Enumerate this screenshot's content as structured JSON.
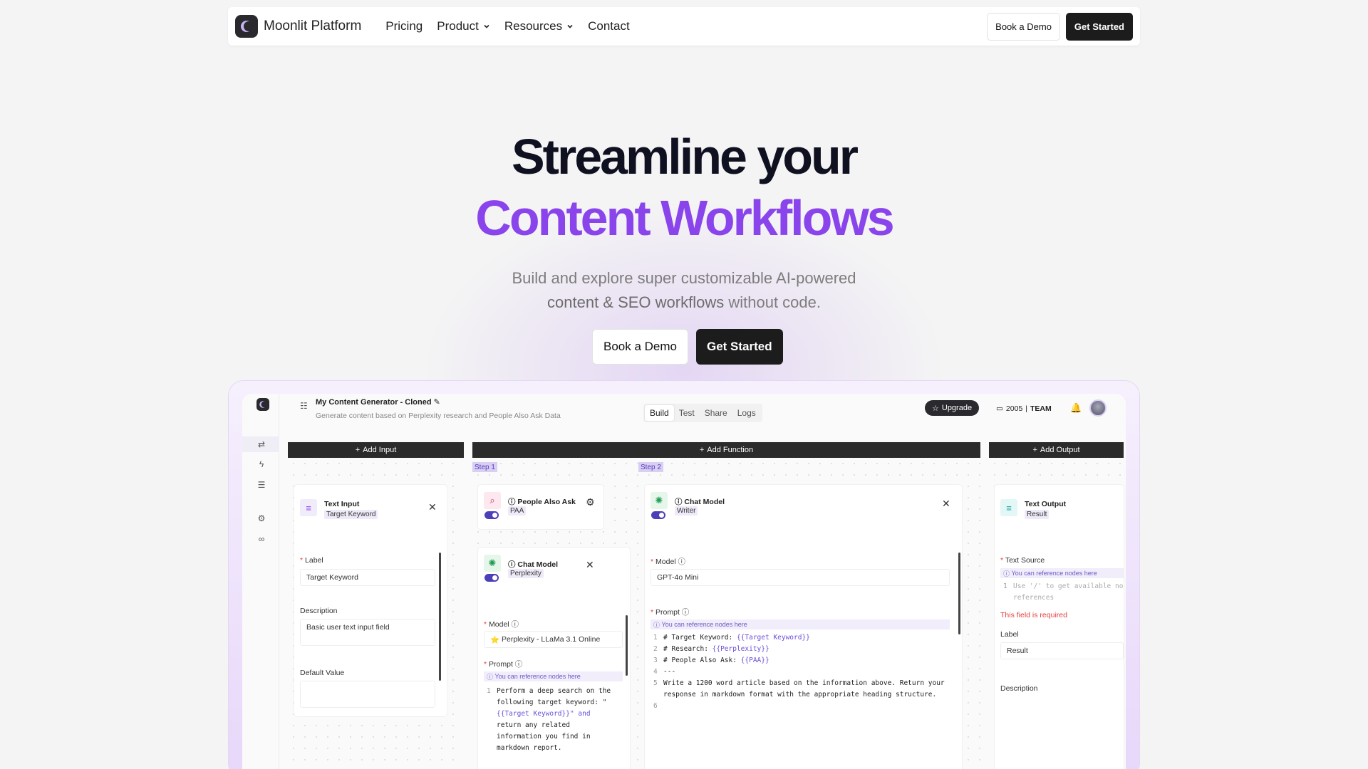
{
  "nav": {
    "brand": "Moonlit Platform",
    "links": [
      "Pricing",
      "Product",
      "Resources",
      "Contact"
    ],
    "book_demo": "Book a Demo",
    "get_started": "Get Started"
  },
  "hero": {
    "title_line1": "Streamline your",
    "title_line2": "Content Workflows",
    "subtitle_line1": "Build and explore super customizable AI-powered",
    "subtitle_line2_strong": "content & SEO workflows",
    "subtitle_line2_rest": " without code.",
    "book_demo": "Book a Demo",
    "get_started": "Get Started"
  },
  "app": {
    "title": "My Content Generator - Cloned",
    "description": "Generate content based on Perplexity research and People Also Ask Data",
    "tabs": [
      "Build",
      "Test",
      "Share",
      "Logs"
    ],
    "upgrade": "Upgrade",
    "credits": "2005",
    "plan": "TEAM",
    "add_input": "Add Input",
    "add_function": "Add Function",
    "add_output": "Add Output",
    "step1": "Step 1",
    "step2": "Step 2",
    "text_input": {
      "title": "Text Input",
      "tag": "Target Keyword",
      "label_label": "Label",
      "label_value": "Target Keyword",
      "description_label": "Description",
      "description_value": "Basic user text input field",
      "default_label": "Default Value"
    },
    "paa": {
      "title": "People Also Ask",
      "tag": "PAA"
    },
    "chat1": {
      "title": "Chat Model",
      "tag": "Perplexity",
      "model_label": "Model",
      "model_value": "Perplexity - LLaMa 3.1 Online",
      "prompt_label": "Prompt",
      "hint": "You can reference nodes here",
      "prompt_lines": [
        "Perform a deep search on the",
        "following target keyword: \"",
        "{{Target Keyword}}\" and",
        "return any related",
        "information you find in",
        "markdown report."
      ]
    },
    "chat2": {
      "title": "Chat Model",
      "tag": "Writer",
      "model_label": "Model",
      "model_value": "GPT-4o Mini",
      "prompt_label": "Prompt",
      "hint": "You can reference nodes here",
      "line1_a": "# Target Keyword: ",
      "line1_b": "{{Target Keyword}}",
      "line2_a": "# Research: ",
      "line2_b": "{{Perplexity}}",
      "line3_a": "# People Also Ask: ",
      "line3_b": "{{PAA}}",
      "line4": "---",
      "line5a": "Write a 1200 word article based on the information above. Return your",
      "line5b": "response in markdown format with the appropriate heading structure."
    },
    "text_output": {
      "title": "Text Output",
      "tag": "Result",
      "source_label": "Text Source",
      "hint": "You can reference nodes here",
      "placeholder_a": "Use '/' to get available no",
      "placeholder_b": "references",
      "error": "This field is required",
      "label_label": "Label",
      "label_value": "Result",
      "description_label": "Description"
    }
  }
}
